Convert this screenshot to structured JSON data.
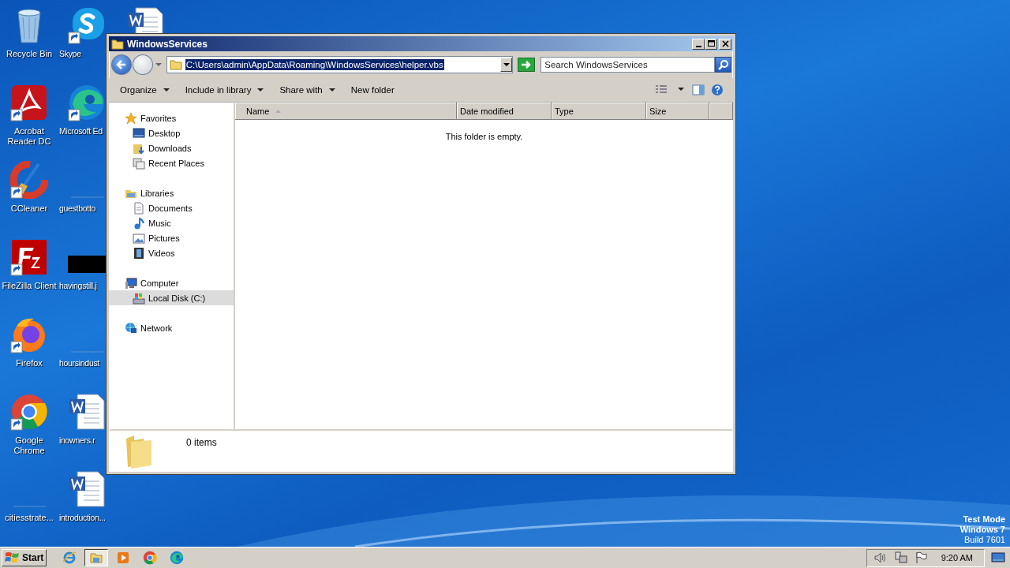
{
  "desktop_icons": [
    {
      "label": "Recycle Bin",
      "kind": "recycle",
      "shortcut": false
    },
    {
      "label": "Acrobat Reader DC",
      "kind": "acrobat",
      "shortcut": true
    },
    {
      "label": "CCleaner",
      "kind": "ccleaner",
      "shortcut": true
    },
    {
      "label": "FileZilla Client",
      "kind": "filezilla",
      "shortcut": true
    },
    {
      "label": "Firefox",
      "kind": "firefox",
      "shortcut": true
    },
    {
      "label": "Google Chrome",
      "kind": "chrome",
      "shortcut": true
    },
    {
      "label": "citiesstrate...",
      "kind": "blank",
      "shortcut": false
    },
    {
      "label": "Skype",
      "kind": "skype",
      "shortcut": true
    },
    {
      "label": "Microsoft Ed",
      "kind": "edge",
      "shortcut": true
    },
    {
      "label": "guestbotto",
      "kind": "blank",
      "shortcut": false
    },
    {
      "label": "havingstill.j",
      "kind": "image",
      "shortcut": false
    },
    {
      "label": "hoursindust",
      "kind": "blank",
      "shortcut": false
    },
    {
      "label": "inowners.r",
      "kind": "word",
      "shortcut": false
    },
    {
      "label": "introduction...",
      "kind": "word",
      "shortcut": false
    },
    {
      "kind": "word",
      "shortcut": false
    }
  ],
  "window": {
    "title": "WindowsServices",
    "address": {
      "value": "C:\\Users\\admin\\AppData\\Roaming\\WindowsServices\\helper.vbs",
      "selected": true
    },
    "search": {
      "placeholder": "Search WindowsServices"
    },
    "toolbar": [
      {
        "label": "Organize",
        "dropdown": true
      },
      {
        "label": "Include in library",
        "dropdown": true
      },
      {
        "label": "Share with",
        "dropdown": true
      },
      {
        "label": "New folder",
        "dropdown": false
      }
    ],
    "navigation": [
      {
        "label": "Favorites",
        "kind": "star",
        "selected": false,
        "children": [
          {
            "label": "Desktop",
            "kind": "desktop",
            "selected": false
          },
          {
            "label": "Downloads",
            "kind": "downloads",
            "selected": false
          },
          {
            "label": "Recent Places",
            "kind": "recent",
            "selected": false
          }
        ]
      },
      {
        "label": "Libraries",
        "kind": "libraries",
        "selected": false,
        "children": [
          {
            "label": "Documents",
            "kind": "documents",
            "selected": false
          },
          {
            "label": "Music",
            "kind": "music",
            "selected": false
          },
          {
            "label": "Pictures",
            "kind": "pictures",
            "selected": false
          },
          {
            "label": "Videos",
            "kind": "videos",
            "selected": false
          }
        ]
      },
      {
        "label": "Computer",
        "kind": "computer",
        "selected": false,
        "children": [
          {
            "label": "Local Disk (C:)",
            "kind": "disk",
            "selected": true
          }
        ]
      },
      {
        "label": "Network",
        "kind": "network",
        "selected": false
      }
    ],
    "columns": [
      {
        "label": "Name",
        "sorted": true
      },
      {
        "label": "Date modified",
        "sorted": false
      },
      {
        "label": "Type",
        "sorted": false
      },
      {
        "label": "Size",
        "sorted": false
      }
    ],
    "empty_message": "This folder is empty.",
    "details": "0 items"
  },
  "watermark_text": [
    "Test Mode",
    "Windows 7",
    "Build 7601"
  ],
  "taskbar": {
    "start": "Start",
    "apps": [
      {
        "kind": "ie",
        "selected": false
      },
      {
        "kind": "explorer",
        "selected": true
      },
      {
        "kind": "media",
        "selected": false
      },
      {
        "kind": "chrome",
        "selected": false
      },
      {
        "kind": "edge",
        "selected": false
      }
    ],
    "time": "9:20 AM"
  }
}
